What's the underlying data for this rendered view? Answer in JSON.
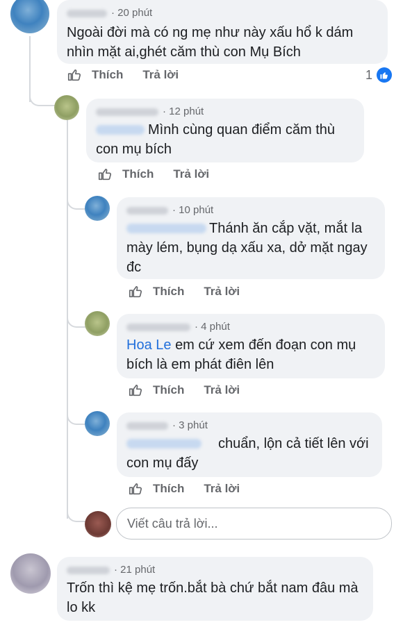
{
  "labels": {
    "like": "Thích",
    "reply": "Trả lời"
  },
  "reply_input": {
    "placeholder": "Viết câu trả lời..."
  },
  "comments": [
    {
      "time": "20 phút",
      "text": "Ngoài đời mà có ng mẹ như này xấu hổ k dám nhìn mặt ai,ghét căm thù con Mụ Bích",
      "reactions": "1"
    },
    {
      "time": "12 phút",
      "text": "Mình cùng quan điểm căm thù con mụ bích"
    },
    {
      "time": "10 phút",
      "text": "Thánh ăn cắp vặt, mắt la mày lém, bụng dạ xấu xa, dở mặt ngay đc"
    },
    {
      "time": "4 phút",
      "mention": "Hoa Le",
      "text": "em cứ xem đến đoạn con mụ bích là em phát điên lên"
    },
    {
      "time": "3 phút",
      "text": "chuẩn, lộn cả tiết lên với con mụ đấy"
    },
    {
      "time": "21 phút",
      "text": "Trốn thì kệ mẹ trốn.bắt bà chứ bắt nam đâu mà lo kk"
    }
  ],
  "colors": {
    "bubble": "#f0f2f5",
    "mention": "#216fdb",
    "meta": "#65676b",
    "reaction": "#1877f2"
  }
}
